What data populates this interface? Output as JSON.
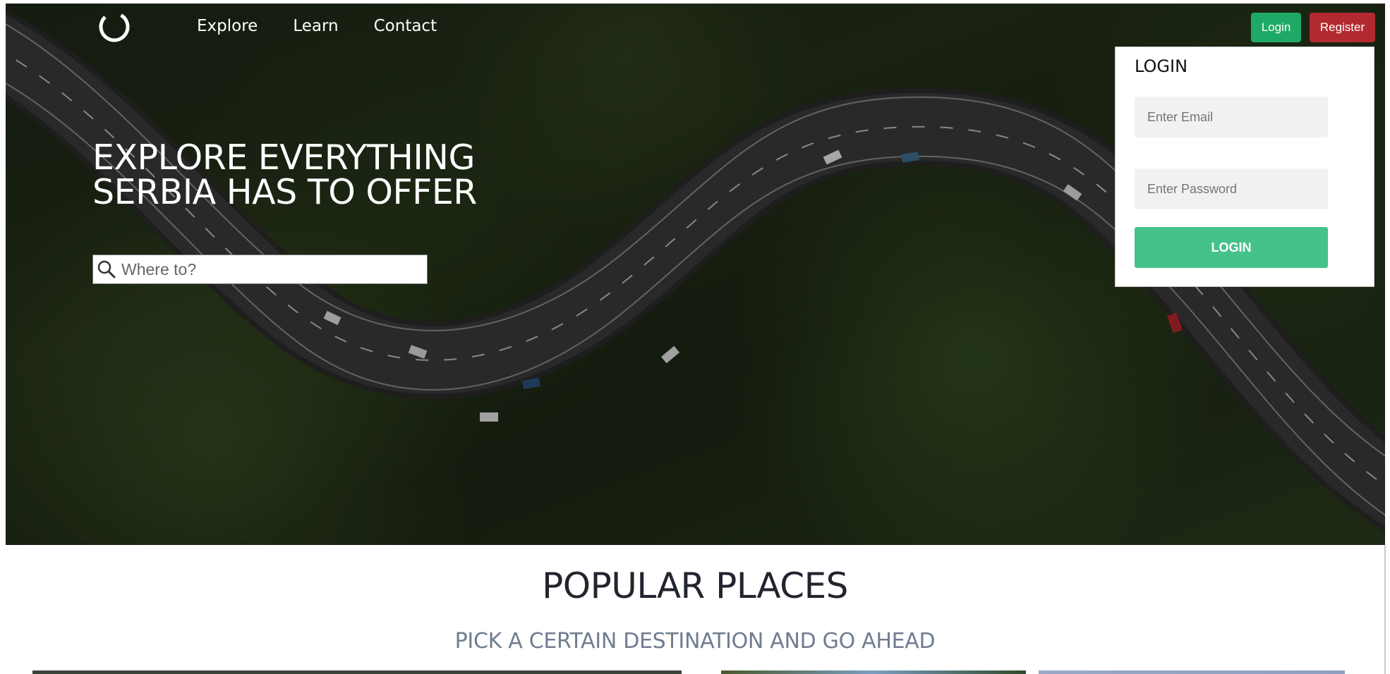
{
  "nav": {
    "items": [
      {
        "label": "Explore"
      },
      {
        "label": "Learn"
      },
      {
        "label": "Contact"
      }
    ]
  },
  "auth": {
    "login_label": "Login",
    "register_label": "Register"
  },
  "hero": {
    "title": "EXPLORE EVERYTHING SERBIA HAS TO OFFER",
    "search": {
      "placeholder": "Where to?"
    }
  },
  "login_form": {
    "title": "LOGIN",
    "email_placeholder": "Enter Email",
    "password_placeholder": "Enter Password",
    "submit_label": "LOGIN"
  },
  "popular": {
    "title": "POPULAR PLACES",
    "subtitle": "PICK A CERTAIN DESTINATION AND GO AHEAD"
  },
  "colors": {
    "login_green": "#1fa966",
    "register_red": "#b22a2f",
    "submit_green": "#45c28a",
    "title_dark": "#22252e",
    "subtitle_gray": "#6f7d8f"
  },
  "icons": {
    "logo": "crescent-logo-icon",
    "search": "search-icon"
  }
}
